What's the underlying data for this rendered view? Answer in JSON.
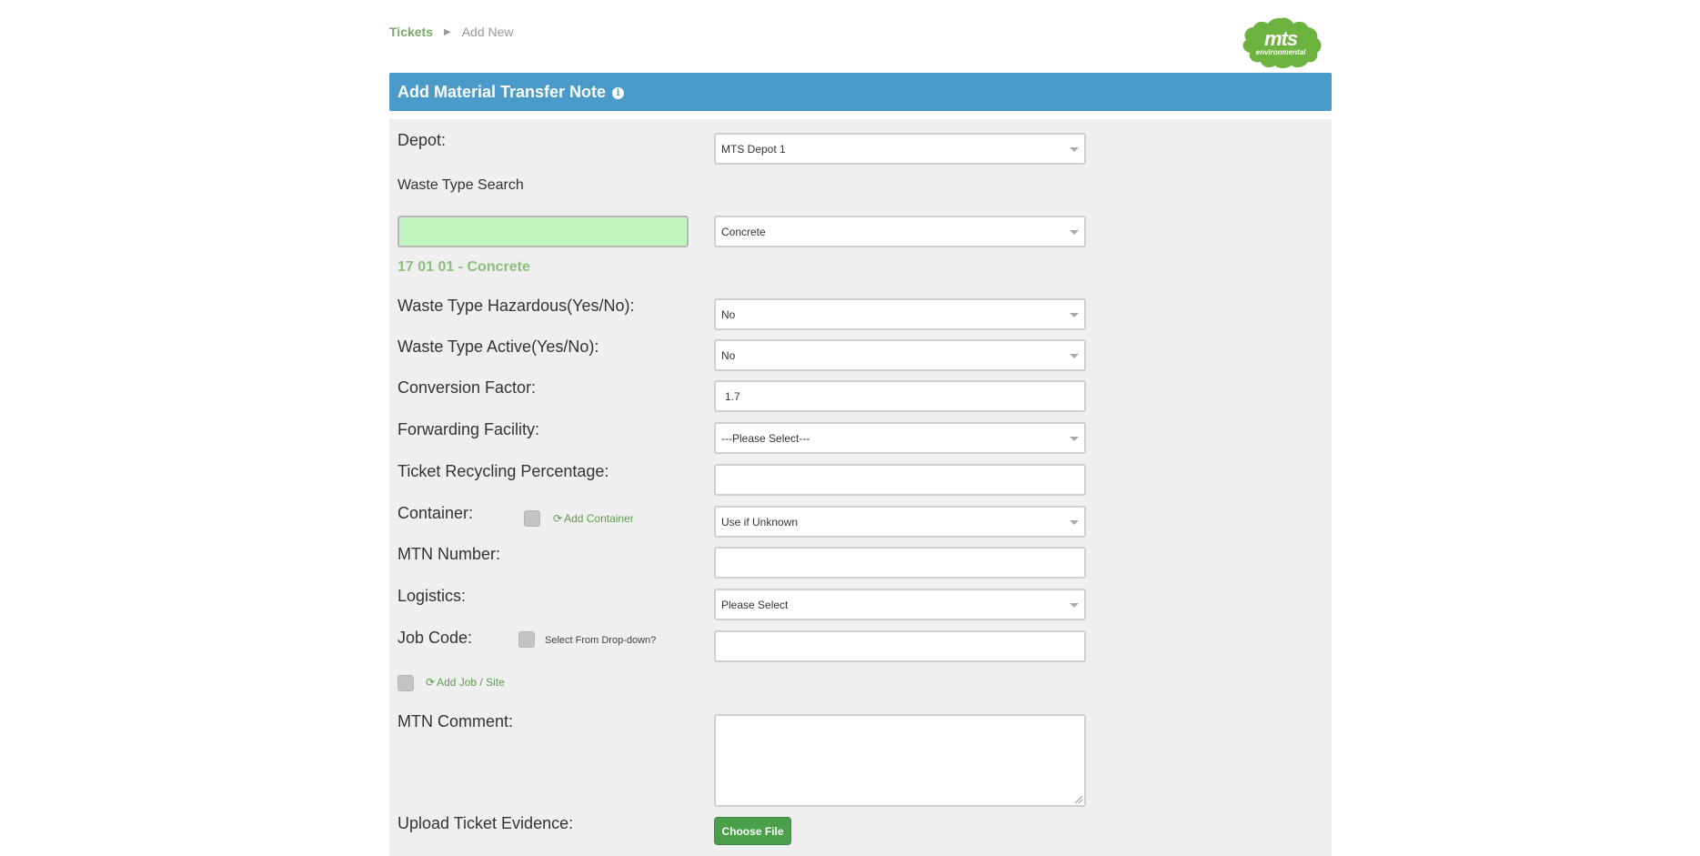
{
  "breadcrumb": {
    "root": "Tickets",
    "current": "Add New"
  },
  "logo": {
    "main": "mts",
    "sub": "environmental",
    "color": "#6db33f"
  },
  "header": {
    "title": "Add Material Transfer Note",
    "info_glyph": "i"
  },
  "form": {
    "depot": {
      "label": "Depot:",
      "value": "MTS Depot 1"
    },
    "waste_search": {
      "label": "Waste Type Search",
      "input_value": "",
      "select_value": "Concrete",
      "code": "17 01 01 - Concrete"
    },
    "hazardous": {
      "label": "Waste Type Hazardous(Yes/No):",
      "value": "No"
    },
    "active": {
      "label": "Waste Type Active(Yes/No):",
      "value": "No"
    },
    "conversion": {
      "label": "Conversion Factor:",
      "value": "1.7"
    },
    "forwarding": {
      "label": "Forwarding Facility:",
      "value": "---Please Select---"
    },
    "recycling": {
      "label": "Ticket Recycling Percentage:",
      "value": ""
    },
    "container": {
      "label": "Container:",
      "add_link": "Add Container",
      "value": "Use if Unknown"
    },
    "mtn_number": {
      "label": "MTN Number:",
      "value": ""
    },
    "logistics": {
      "label": "Logistics:",
      "value": "Please Select"
    },
    "job_code": {
      "label": "Job Code:",
      "checkbox_label": "Select From Drop-down?",
      "value": ""
    },
    "job_site": {
      "add_link": "Add Job / Site"
    },
    "comment": {
      "label": "MTN Comment:",
      "value": ""
    },
    "upload": {
      "label": "Upload Ticket Evidence:",
      "button": "Choose File"
    }
  },
  "colors": {
    "header_bg": "#4a9bca",
    "accent_green": "#4aa04a",
    "search_bg": "#c0f5c0",
    "code_green": "#8bbf7a"
  }
}
